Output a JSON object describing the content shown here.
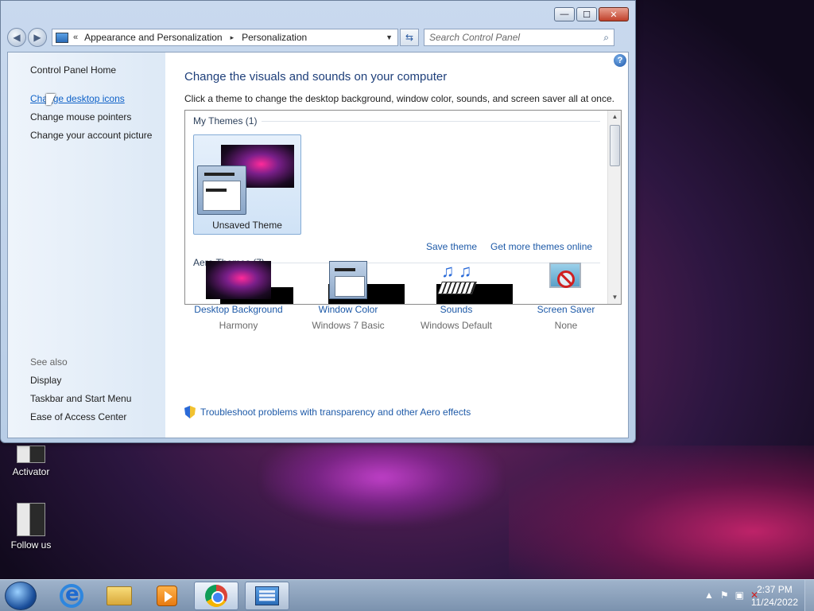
{
  "window": {
    "controls": {
      "minimize": "—",
      "maximize": "☐",
      "close": "✕"
    },
    "nav": {
      "back": "◀",
      "forward": "▶"
    },
    "address": {
      "chevron": "«",
      "crumbs": [
        "Appearance and Personalization",
        "Personalization"
      ],
      "separator": "▸",
      "dropdown": "▼"
    },
    "refresh_icon": "⇆",
    "search": {
      "placeholder": "Search Control Panel",
      "icon": "⌕"
    }
  },
  "sidebar": {
    "home": "Control Panel Home",
    "links": [
      "Change desktop icons",
      "Change mouse pointers",
      "Change your account picture"
    ],
    "see_also_title": "See also",
    "see_also": [
      "Display",
      "Taskbar and Start Menu",
      "Ease of Access Center"
    ]
  },
  "main": {
    "help": "?",
    "heading": "Change the visuals and sounds on your computer",
    "subtext": "Click a theme to change the desktop background, window color, sounds, and screen saver all at once.",
    "my_themes_title": "My Themes (1)",
    "selected_theme": "Unsaved Theme",
    "save_theme": "Save theme",
    "get_more": "Get more themes online",
    "aero_themes_title": "Aero Themes (7)",
    "scroll": {
      "up": "▲",
      "down": "▼"
    },
    "options": [
      {
        "label": "Desktop Background",
        "value": "Harmony",
        "icon": "wallpaper-icon"
      },
      {
        "label": "Window Color",
        "value": "Windows 7 Basic",
        "icon": "window-color-icon"
      },
      {
        "label": "Sounds",
        "value": "Windows Default",
        "icon": "sounds-icon"
      },
      {
        "label": "Screen Saver",
        "value": "None",
        "icon": "screen-saver-icon"
      }
    ],
    "troubleshoot": "Troubleshoot problems with transparency and other Aero effects"
  },
  "desktop": {
    "icons": [
      "Activator",
      "Follow us"
    ]
  },
  "taskbar": {
    "tray": {
      "arrow": "▲",
      "flag": "⚑",
      "network": "▣",
      "volume": "✕"
    },
    "clock": {
      "time": "2:37 PM",
      "date": "11/24/2022"
    }
  }
}
